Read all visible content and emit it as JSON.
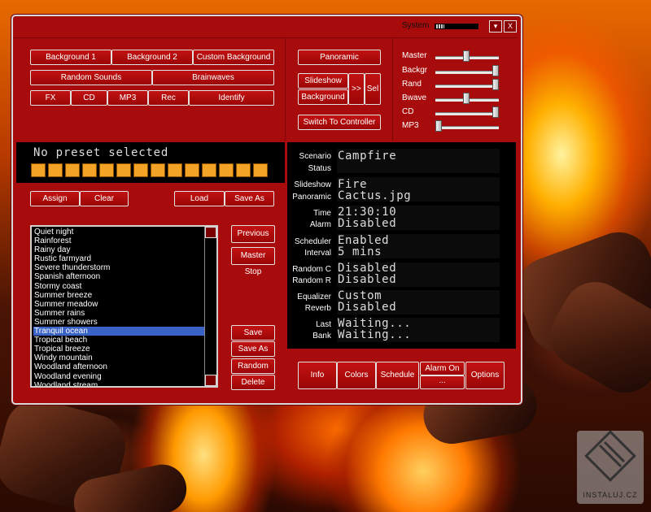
{
  "topbar": {
    "system_label": "System",
    "menu_glyph": "▾",
    "close_glyph": "X"
  },
  "buttons": {
    "background1": "Background 1",
    "background2": "Background 2",
    "custom_background": "Custom Background",
    "random_sounds": "Random Sounds",
    "brainwaves": "Brainwaves",
    "fx": "FX",
    "cd": "CD",
    "mp3": "MP3",
    "rec": "Rec",
    "identify": "Identify",
    "panoramic": "Panoramic",
    "slideshow": "Slideshow",
    "background": "Background",
    "next": ">>",
    "sel": "Sel",
    "switch_to_controller": "Switch To Controller",
    "assign": "Assign",
    "clear": "Clear",
    "load": "Load",
    "save_as_top": "Save As",
    "previous": "Previous",
    "master_stop": "Master Stop",
    "save": "Save",
    "save_as": "Save As",
    "random": "Random",
    "delete": "Delete",
    "info": "Info",
    "colors": "Colors",
    "schedule": "Schedule",
    "alarm_on": "Alarm On",
    "alarm_sub": "...",
    "options": "Options"
  },
  "sliders": [
    {
      "label": "Master",
      "value": 0.48
    },
    {
      "label": "Backgr",
      "value": 1.0
    },
    {
      "label": "Rand",
      "value": 1.0
    },
    {
      "label": "Bwave",
      "value": 0.48
    },
    {
      "label": "CD",
      "value": 1.0
    },
    {
      "label": "MP3",
      "value": 0.0
    }
  ],
  "preset": {
    "text": "No preset selected",
    "segments": 14
  },
  "presets_list": [
    "Quiet night",
    "Rainforest",
    "Rainy day",
    "Rustic farmyard",
    "Severe thunderstorm",
    "Spanish afternoon",
    "Stormy coast",
    "Summer breeze",
    "Summer meadow",
    "Summer rains",
    "Summer showers",
    "Tranquil ocean",
    "Tropical beach",
    "Tropical breeze",
    "Windy mountain",
    "Woodland afternoon",
    "Woodland evening",
    "Woodland stream"
  ],
  "selected_preset": "Tranquil ocean",
  "info": {
    "scenario_label": "Scenario",
    "scenario_value": "Campfire",
    "status_label": "Status",
    "status_value": "",
    "slideshow_label": "Slideshow",
    "slideshow_value": "Fire",
    "panoramic_label": "Panoramic",
    "panoramic_value": "Cactus.jpg",
    "time_label": "Time",
    "time_value": "21:30:10",
    "alarm_label": "Alarm",
    "alarm_value": "Disabled",
    "scheduler_label": "Scheduler",
    "scheduler_value": "Enabled",
    "interval_label": "Interval",
    "interval_value": "5 mins",
    "randomc_label": "Random C",
    "randomc_value": "Disabled",
    "randomr_label": "Random R",
    "randomr_value": "Disabled",
    "equalizer_label": "Equalizer",
    "equalizer_value": "Custom",
    "reverb_label": "Reverb",
    "reverb_value": "Disabled",
    "last_label": "Last",
    "last_value": "Waiting...",
    "bank_label": "Bank",
    "bank_value": "Waiting..."
  },
  "watermark": {
    "text": "INSTALUJ.CZ"
  },
  "colors": {
    "window": "#a80b0b",
    "selection": "#3a63c8",
    "segment": "#f3a325"
  }
}
